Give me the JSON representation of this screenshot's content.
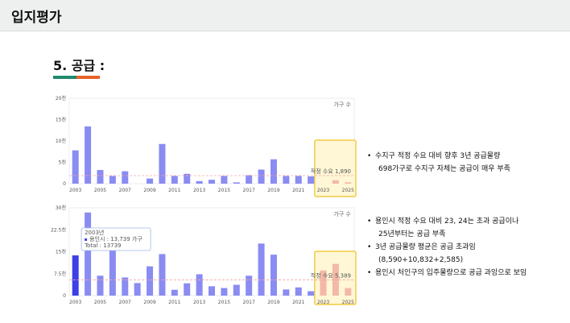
{
  "header": {
    "title": "입지평가"
  },
  "section": {
    "title": "5. 공급 :"
  },
  "notes1": [
    {
      "text": "수지구 적정 수요 대비 향후 3년 공급물량",
      "bullet": true
    },
    {
      "text": "698가구로 수지구 자체는 공급이 매우 부족",
      "bullet": false
    }
  ],
  "notes2": [
    {
      "text": "용인시 적정 수요 대비 23, 24는 초과 공급이나",
      "bullet": true
    },
    {
      "text": "25년부터는 공급 부족",
      "bullet": false
    },
    {
      "text": "3년 공급물량 평균은 공급 초과임",
      "bullet": true
    },
    {
      "text": "(8,590+10,832+2,585)",
      "bullet": false
    },
    {
      "text": "용인시 처인구의 입주물량으로 공급 과잉으로 보임",
      "bullet": true
    }
  ],
  "colors": {
    "bar": "#8a8cf2",
    "bar_selected": "#3b40e8",
    "future_bar": "#f4b8a8",
    "highlight_border": "#f0c020",
    "highlight_fill": "#fff7d6",
    "demand_line": "#f2a6a6",
    "accent_green": "#1f8a70",
    "accent_orange": "#e8632a"
  },
  "chart_data": [
    {
      "type": "bar",
      "unit_label": "가구 수",
      "ylim": [
        0,
        20000
      ],
      "yticks": [
        {
          "v": 0,
          "label": "0"
        },
        {
          "v": 5000,
          "label": "5천"
        },
        {
          "v": 10000,
          "label": "10천"
        },
        {
          "v": 15000,
          "label": "15천"
        },
        {
          "v": 20000,
          "label": "20천"
        }
      ],
      "x": [
        2003,
        2004,
        2005,
        2006,
        2007,
        2008,
        2009,
        2010,
        2011,
        2012,
        2013,
        2014,
        2015,
        2016,
        2017,
        2018,
        2019,
        2020,
        2021,
        2022,
        2023,
        2024,
        2025
      ],
      "values": [
        7800,
        13400,
        3200,
        1800,
        2900,
        0,
        1200,
        9300,
        1800,
        2300,
        600,
        900,
        1800,
        300,
        2000,
        3300,
        5700,
        1800,
        1800,
        1700,
        0,
        800,
        300
      ],
      "xticks": [
        2003,
        2005,
        2007,
        2009,
        2011,
        2013,
        2015,
        2017,
        2019,
        2021,
        2023,
        2025
      ],
      "demand": 1890,
      "demand_label": "적정 수요 1,890",
      "highlight_from": 2023,
      "grid": false,
      "legend": "none"
    },
    {
      "type": "bar",
      "unit_label": "가구 수",
      "ylim": [
        0,
        30000
      ],
      "yticks": [
        {
          "v": 0,
          "label": "0"
        },
        {
          "v": 7500,
          "label": "7.5천"
        },
        {
          "v": 15000,
          "label": "15천"
        },
        {
          "v": 22500,
          "label": "22.5천"
        },
        {
          "v": 30000,
          "label": "30천"
        }
      ],
      "x": [
        2003,
        2004,
        2005,
        2006,
        2007,
        2008,
        2009,
        2010,
        2011,
        2012,
        2013,
        2014,
        2015,
        2016,
        2017,
        2018,
        2019,
        2020,
        2021,
        2022,
        2023,
        2024,
        2025
      ],
      "values": [
        13739,
        28400,
        6800,
        16000,
        6200,
        4300,
        10000,
        14200,
        2000,
        4200,
        7300,
        3200,
        2600,
        3700,
        6800,
        17800,
        14000,
        2100,
        2800,
        1500,
        8590,
        10832,
        2585
      ],
      "xticks": [
        2003,
        2005,
        2007,
        2009,
        2011,
        2013,
        2015,
        2017,
        2019,
        2021,
        2023,
        2025
      ],
      "demand": 5389,
      "demand_label": "적정 수요 5,389",
      "highlight_from": 2023,
      "selected": 2003,
      "tooltip": {
        "year": "2003년",
        "series_line": "용인시 : 13,739 가구",
        "total_line": "Total : 13739"
      },
      "grid": false,
      "legend": "none"
    }
  ]
}
